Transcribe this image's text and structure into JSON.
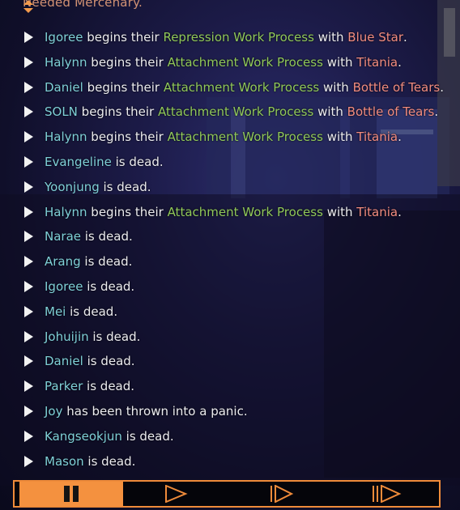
{
  "header": {
    "cut_text": "Needed Mercenary."
  },
  "log": [
    {
      "parts": [
        {
          "t": "Igoree",
          "c": "actor"
        },
        {
          "t": " begins their ",
          "c": "plain"
        },
        {
          "t": "Repression Work Process",
          "c": "work"
        },
        {
          "t": " with ",
          "c": "plain"
        },
        {
          "t": "Blue Star",
          "c": "abno"
        },
        {
          "t": ".",
          "c": "plain"
        }
      ]
    },
    {
      "parts": [
        {
          "t": "Halynn",
          "c": "actor"
        },
        {
          "t": " begins their ",
          "c": "plain"
        },
        {
          "t": "Attachment Work Process",
          "c": "work"
        },
        {
          "t": " with ",
          "c": "plain"
        },
        {
          "t": "Titania",
          "c": "abno"
        },
        {
          "t": ".",
          "c": "plain"
        }
      ]
    },
    {
      "parts": [
        {
          "t": "Daniel",
          "c": "actor"
        },
        {
          "t": " begins their ",
          "c": "plain"
        },
        {
          "t": "Attachment Work Process",
          "c": "work"
        },
        {
          "t": " with ",
          "c": "plain"
        },
        {
          "t": "Bottle of Tears",
          "c": "abno"
        },
        {
          "t": ".",
          "c": "plain"
        }
      ]
    },
    {
      "parts": [
        {
          "t": "SOLN",
          "c": "actor"
        },
        {
          "t": " begins their ",
          "c": "plain"
        },
        {
          "t": "Attachment Work Process",
          "c": "work"
        },
        {
          "t": " with ",
          "c": "plain"
        },
        {
          "t": "Bottle of Tears",
          "c": "abno"
        },
        {
          "t": ".",
          "c": "plain"
        }
      ]
    },
    {
      "parts": [
        {
          "t": "Halynn",
          "c": "actor"
        },
        {
          "t": " begins their ",
          "c": "plain"
        },
        {
          "t": "Attachment Work Process",
          "c": "work"
        },
        {
          "t": " with ",
          "c": "plain"
        },
        {
          "t": "Titania",
          "c": "abno"
        },
        {
          "t": ".",
          "c": "plain"
        }
      ]
    },
    {
      "parts": [
        {
          "t": "Evangeline",
          "c": "actor"
        },
        {
          "t": " is dead.",
          "c": "plain"
        }
      ]
    },
    {
      "parts": [
        {
          "t": "Yoonjung",
          "c": "actor"
        },
        {
          "t": " is dead.",
          "c": "plain"
        }
      ]
    },
    {
      "parts": [
        {
          "t": "Halynn",
          "c": "actor"
        },
        {
          "t": " begins their ",
          "c": "plain"
        },
        {
          "t": "Attachment Work Process",
          "c": "work"
        },
        {
          "t": " with ",
          "c": "plain"
        },
        {
          "t": "Titania",
          "c": "abno"
        },
        {
          "t": ".",
          "c": "plain"
        }
      ]
    },
    {
      "parts": [
        {
          "t": "Narae",
          "c": "actor"
        },
        {
          "t": " is dead.",
          "c": "plain"
        }
      ]
    },
    {
      "parts": [
        {
          "t": "Arang",
          "c": "actor"
        },
        {
          "t": " is dead.",
          "c": "plain"
        }
      ]
    },
    {
      "parts": [
        {
          "t": "Igoree",
          "c": "actor"
        },
        {
          "t": " is dead.",
          "c": "plain"
        }
      ]
    },
    {
      "parts": [
        {
          "t": "Mei",
          "c": "actor"
        },
        {
          "t": " is dead.",
          "c": "plain"
        }
      ]
    },
    {
      "parts": [
        {
          "t": "Johuijin",
          "c": "actor"
        },
        {
          "t": " is dead.",
          "c": "plain"
        }
      ]
    },
    {
      "parts": [
        {
          "t": "Daniel",
          "c": "actor"
        },
        {
          "t": " is dead.",
          "c": "plain"
        }
      ]
    },
    {
      "parts": [
        {
          "t": "Parker",
          "c": "actor"
        },
        {
          "t": " is dead.",
          "c": "plain"
        }
      ]
    },
    {
      "parts": [
        {
          "t": "Joy",
          "c": "actor"
        },
        {
          "t": " has been thrown into a panic.",
          "c": "plain"
        }
      ]
    },
    {
      "parts": [
        {
          "t": "Kangseokjun",
          "c": "actor"
        },
        {
          "t": " is dead.",
          "c": "plain"
        }
      ]
    },
    {
      "parts": [
        {
          "t": "Mason",
          "c": "actor"
        },
        {
          "t": " is dead.",
          "c": "plain"
        }
      ]
    }
  ],
  "controls": [
    {
      "name": "pause-button",
      "icon": "pause-icon",
      "active": true
    },
    {
      "name": "play-button",
      "icon": "play-icon",
      "active": false
    },
    {
      "name": "fast-forward-button",
      "icon": "fast-forward-icon",
      "active": false
    },
    {
      "name": "fastest-forward-button",
      "icon": "fastest-forward-icon",
      "active": false
    }
  ],
  "colors": {
    "actor": "#7fd0d8",
    "work": "#90c85a",
    "abnormality": "#f28c80",
    "accent": "#f4913f"
  }
}
